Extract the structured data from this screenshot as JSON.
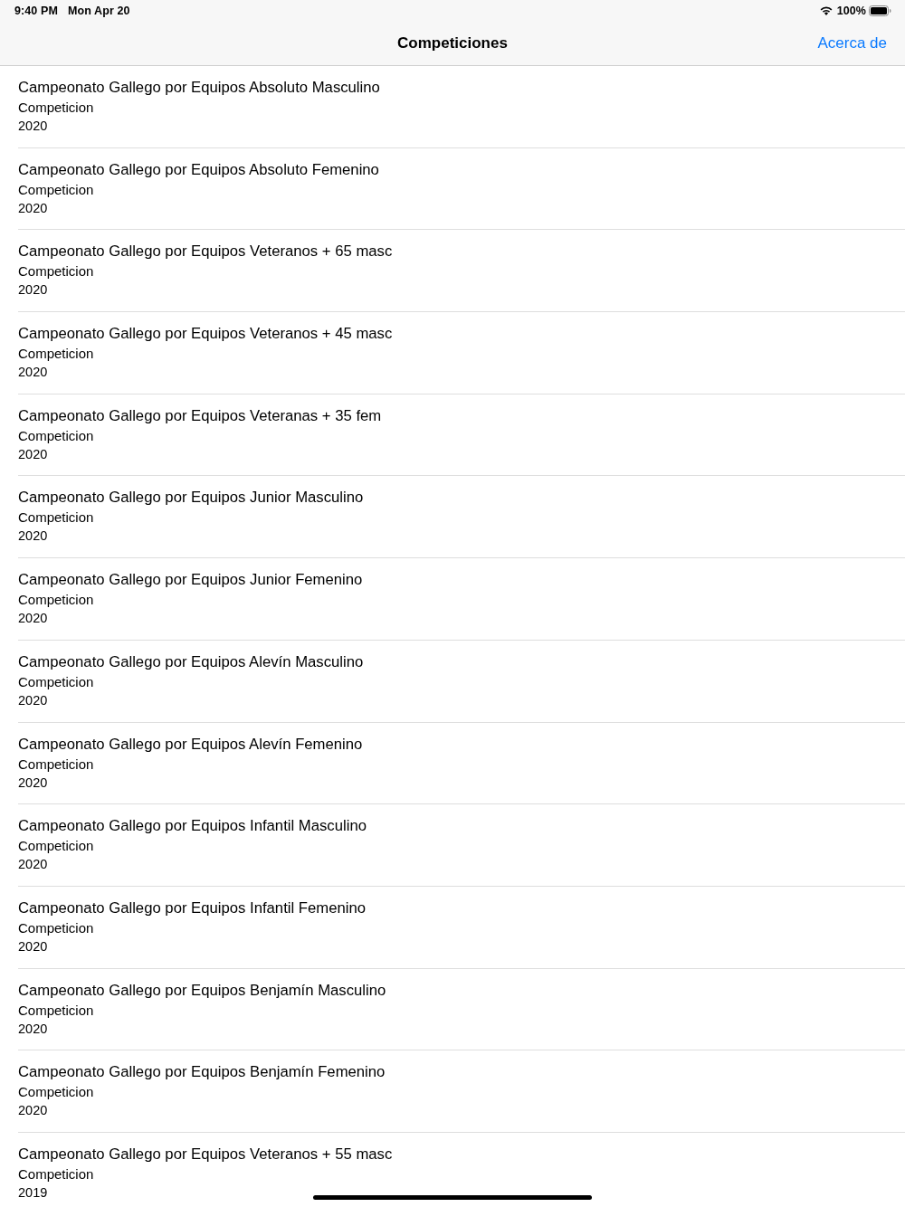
{
  "status_bar": {
    "time": "9:40 PM",
    "date": "Mon Apr 20",
    "battery": "100%"
  },
  "nav_bar": {
    "title": "Competiciones",
    "right_button": "Acerca de"
  },
  "competitions": [
    {
      "title": "Campeonato Gallego por Equipos Absoluto Masculino",
      "subtitle": "Competicion",
      "year": "2020"
    },
    {
      "title": "Campeonato Gallego por Equipos Absoluto Femenino",
      "subtitle": "Competicion",
      "year": "2020"
    },
    {
      "title": "Campeonato Gallego por Equipos Veteranos + 65 masc",
      "subtitle": "Competicion",
      "year": "2020"
    },
    {
      "title": "Campeonato Gallego por Equipos Veteranos + 45 masc",
      "subtitle": "Competicion",
      "year": "2020"
    },
    {
      "title": "Campeonato Gallego por Equipos Veteranas + 35 fem",
      "subtitle": "Competicion",
      "year": "2020"
    },
    {
      "title": "Campeonato Gallego por Equipos Junior Masculino",
      "subtitle": "Competicion",
      "year": "2020"
    },
    {
      "title": "Campeonato Gallego por Equipos Junior Femenino",
      "subtitle": "Competicion",
      "year": "2020"
    },
    {
      "title": "Campeonato Gallego por Equipos Alevín Masculino",
      "subtitle": "Competicion",
      "year": "2020"
    },
    {
      "title": "Campeonato Gallego por Equipos Alevín Femenino",
      "subtitle": "Competicion",
      "year": "2020"
    },
    {
      "title": "Campeonato Gallego por Equipos Infantil Masculino",
      "subtitle": "Competicion",
      "year": "2020"
    },
    {
      "title": "Campeonato Gallego por Equipos Infantil Femenino",
      "subtitle": "Competicion",
      "year": "2020"
    },
    {
      "title": "Campeonato Gallego por Equipos Benjamín Masculino",
      "subtitle": "Competicion",
      "year": "2020"
    },
    {
      "title": "Campeonato Gallego por Equipos Benjamín Femenino",
      "subtitle": "Competicion",
      "year": "2020"
    },
    {
      "title": "Campeonato Gallego por Equipos Veteranos + 55 masc",
      "subtitle": "Competicion",
      "year": "2019"
    }
  ]
}
